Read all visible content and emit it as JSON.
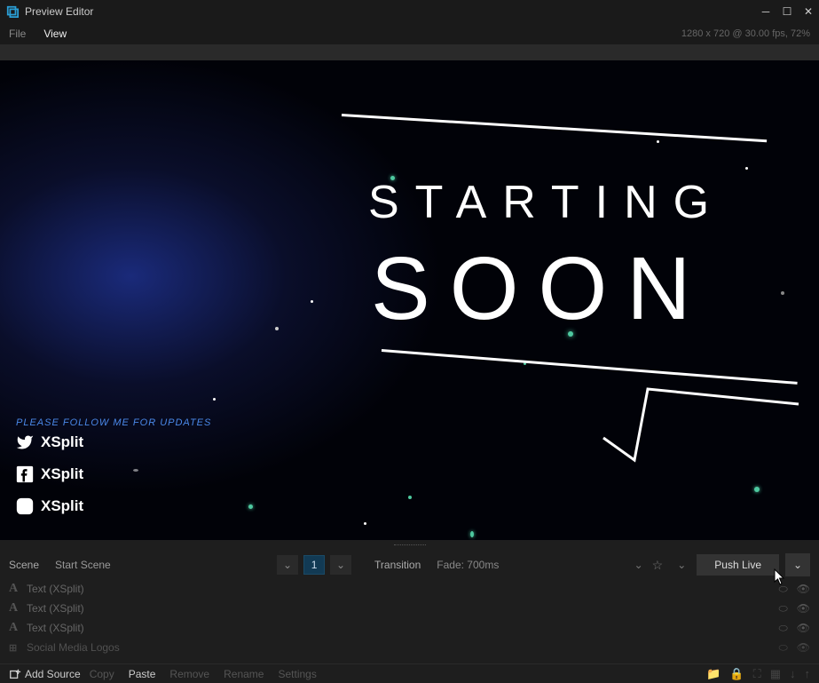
{
  "window": {
    "title": "Preview Editor"
  },
  "menu": {
    "file": "File",
    "view": "View",
    "status": "1280 x 720 @ 30.00 fps, 72%"
  },
  "preview": {
    "starting": "STARTING",
    "soon": "SOON",
    "follow": "PLEASE FOLLOW ME FOR UPDATES",
    "social_twitter": "XSplit",
    "social_facebook": "XSplit",
    "social_instagram": "XSplit"
  },
  "scenebar": {
    "scene_label": "Scene",
    "scene_name": "Start Scene",
    "scene_num": "1",
    "transition_label": "Transition",
    "transition_value": "Fade: 700ms",
    "push": "Push Live"
  },
  "sources": [
    {
      "icon": "A",
      "name": "Text (XSplit)"
    },
    {
      "icon": "A",
      "name": "Text (XSplit)"
    },
    {
      "icon": "A",
      "name": "Text (XSplit)"
    },
    {
      "icon": "⊞",
      "name": "Social Media Logos"
    }
  ],
  "footer": {
    "add": "Add Source",
    "copy": "Copy",
    "paste": "Paste",
    "remove": "Remove",
    "rename": "Rename",
    "settings": "Settings"
  }
}
